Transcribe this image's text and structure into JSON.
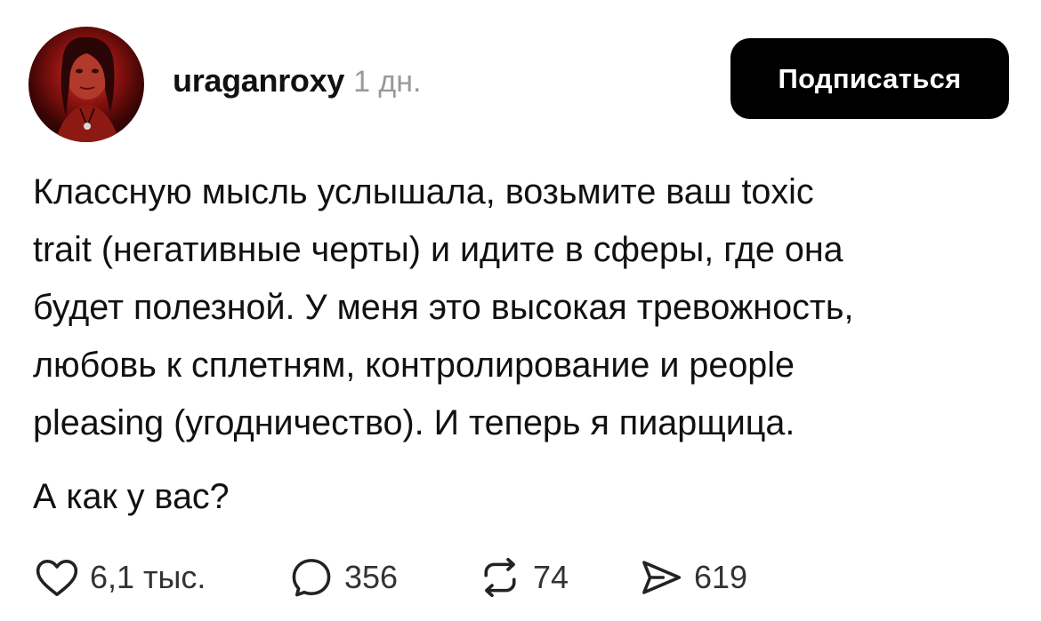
{
  "post": {
    "author": {
      "username": "uraganroxy",
      "time": "1 дн."
    },
    "follow_label": "Подписаться",
    "text_lines": [
      "Классную мысль услышала, возьмите ваш toxic",
      "trait (негативные черты) и идите в сферы, где она",
      "будет полезной. У меня это высокая тревожность,",
      "любовь к сплетням, контролирование и people",
      "pleasing (угодничество). И теперь я пиарщица."
    ],
    "question": "А как у вас?",
    "actions": {
      "likes": {
        "icon": "heart-icon",
        "count": "6,1 тыс."
      },
      "comments": {
        "icon": "comment-bubble-icon",
        "count": "356"
      },
      "reposts": {
        "icon": "repost-icon",
        "count": "74"
      },
      "shares": {
        "icon": "send-icon",
        "count": "619"
      }
    }
  },
  "colors": {
    "button_bg": "#000000",
    "button_text": "#ffffff",
    "secondary_text": "#9a9a9a"
  }
}
